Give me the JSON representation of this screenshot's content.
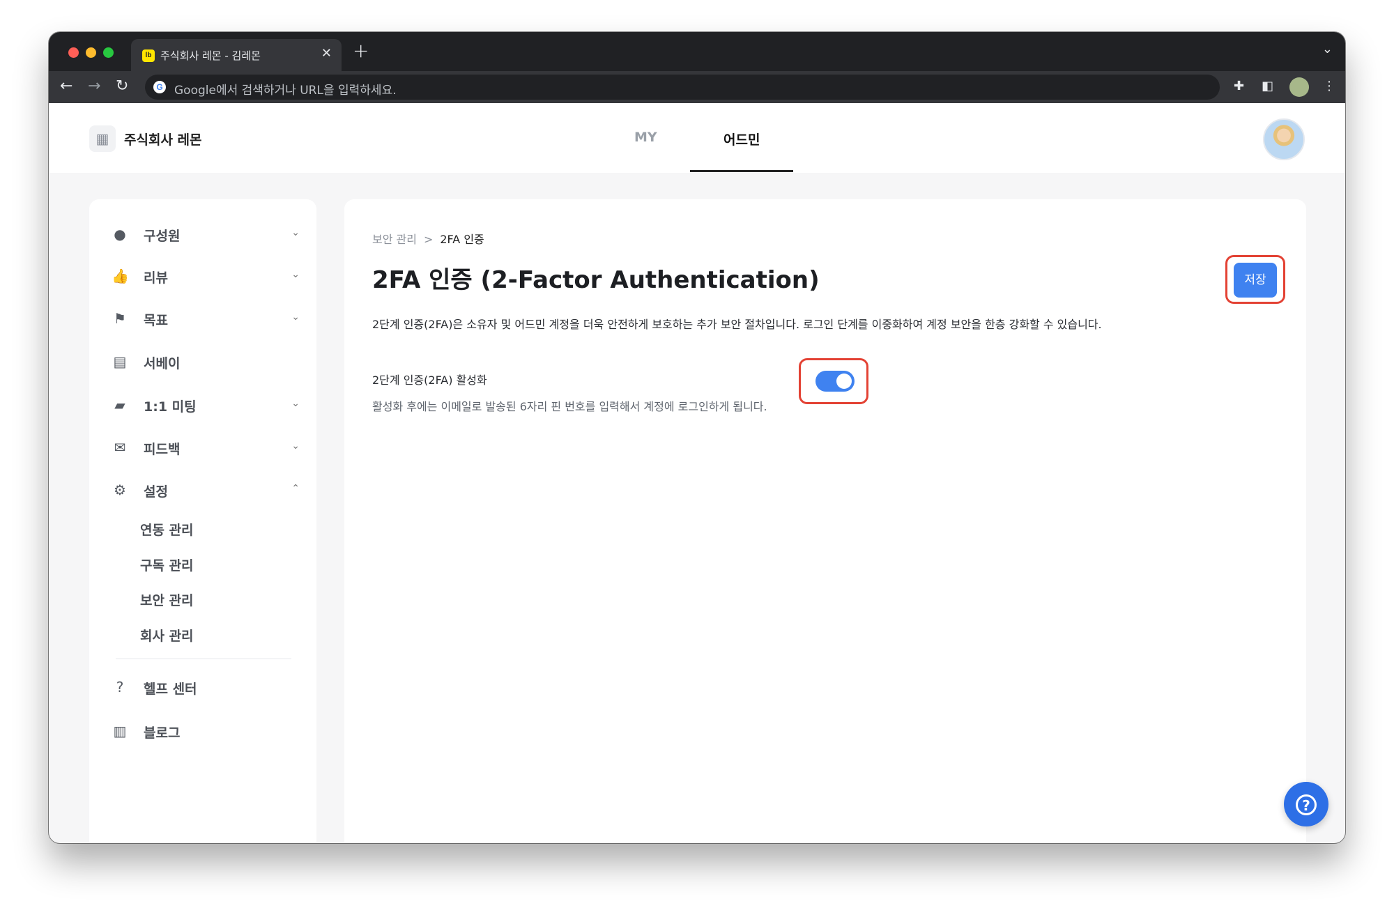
{
  "browser": {
    "tab_title": "주식회사 레몬 - 김레몬",
    "tab_favicon": "lb",
    "omnibox_placeholder": "Google에서 검색하거나 URL을 입력하세요.",
    "google_letter": "G"
  },
  "app": {
    "company_name": "주식회사 레몬",
    "top_tabs": [
      {
        "label": "MY",
        "active": false
      },
      {
        "label": "어드민",
        "active": true
      }
    ]
  },
  "sidebar": {
    "items": [
      {
        "label": "구성원",
        "icon": "person-icon",
        "expanded": false
      },
      {
        "label": "리뷰",
        "icon": "thumbs-up-icon",
        "expanded": false
      },
      {
        "label": "목표",
        "icon": "flag-icon",
        "expanded": false
      },
      {
        "label": "서베이",
        "icon": "document-icon"
      },
      {
        "label": "1:1 미팅",
        "icon": "chat-icon",
        "expanded": false
      },
      {
        "label": "피드백",
        "icon": "mail-icon",
        "expanded": false
      },
      {
        "label": "설정",
        "icon": "gear-icon",
        "expanded": true
      }
    ],
    "sub_items": [
      "연동 관리",
      "구독 관리",
      "보안 관리",
      "회사 관리"
    ],
    "bottom_items": [
      {
        "label": "헬프 센터",
        "icon": "help-icon"
      },
      {
        "label": "블로그",
        "icon": "book-icon"
      }
    ]
  },
  "main": {
    "breadcrumb": {
      "parent": "보안 관리",
      "separator": ">",
      "current": "2FA 인증"
    },
    "title": "2FA 인증 (2-Factor Authentication)",
    "save_label": "저장",
    "description": "2단계 인증(2FA)은 소유자 및 어드민 계정을 더욱 안전하게 보호하는 추가 보안 절차입니다. 로그인 단계를 이중화하여 계정 보안을 한층 강화할 수 있습니다.",
    "setting_label": "2단계 인증(2FA) 활성화",
    "setting_help": "활성화 후에는 이메일로 발송된 6자리 핀 번호를 입력해서 계정에 로그인하게 됩니다.",
    "toggle_on": true
  },
  "help_fab": "?",
  "colors": {
    "accent": "#3f82f0",
    "highlight": "#e34234"
  }
}
